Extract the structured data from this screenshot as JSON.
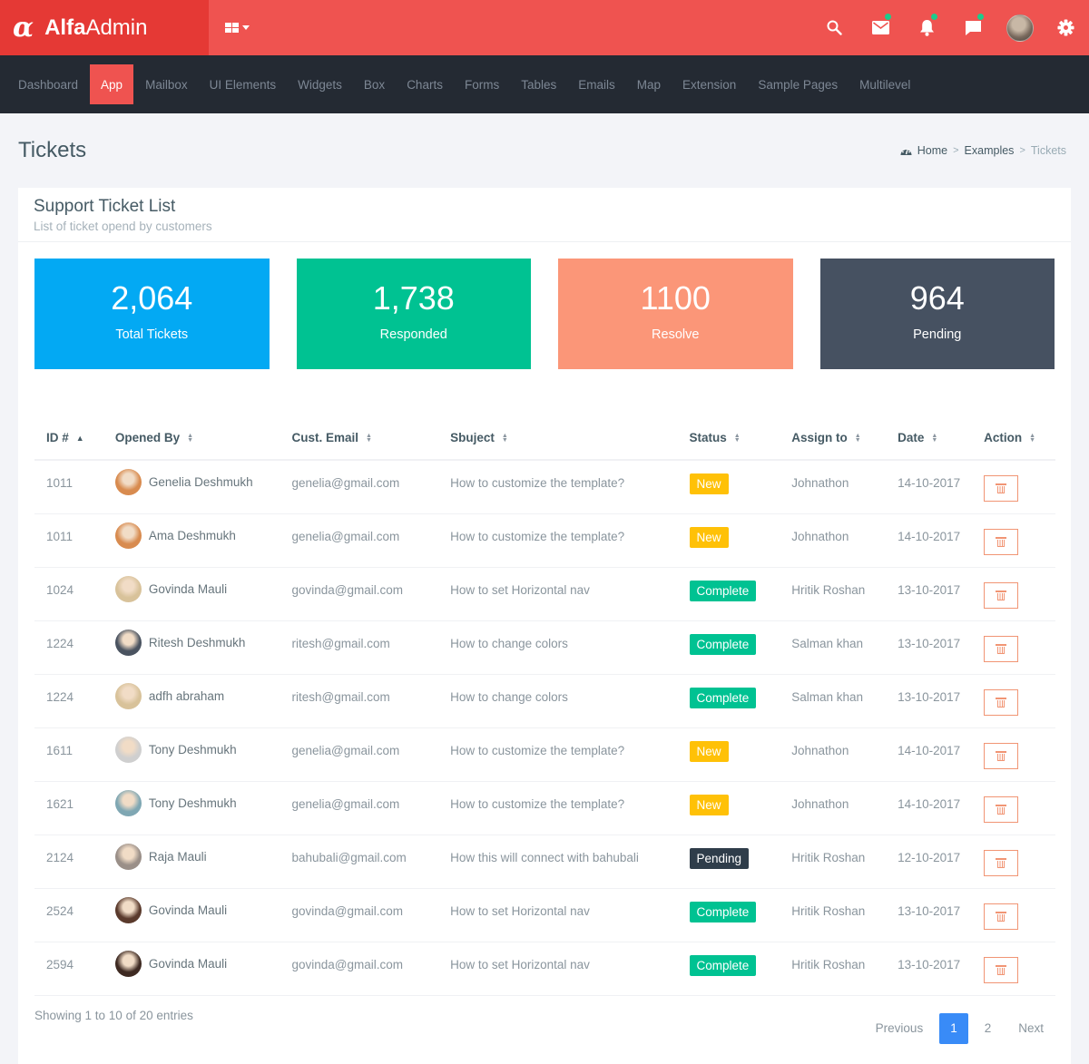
{
  "app": {
    "logo_glyph": "α",
    "brand_bold": "Alfa",
    "brand_light": "Admin",
    "colors": {
      "primary": "#ef5350",
      "brand_bg": "#e53935",
      "nav_bg": "#242a33",
      "notify_dot": "#1ccc8c"
    }
  },
  "topbar": {
    "icons": [
      {
        "name": "search-icon",
        "badge": false
      },
      {
        "name": "mail-icon",
        "badge": true
      },
      {
        "name": "bell-icon",
        "badge": true
      },
      {
        "name": "chat-icon",
        "badge": true
      },
      {
        "name": "user-avatar",
        "badge": false
      },
      {
        "name": "gear-icon",
        "badge": false
      }
    ]
  },
  "nav": {
    "items": [
      {
        "label": "Dashboard",
        "active": false
      },
      {
        "label": "App",
        "active": true
      },
      {
        "label": "Mailbox",
        "active": false
      },
      {
        "label": "UI Elements",
        "active": false
      },
      {
        "label": "Widgets",
        "active": false
      },
      {
        "label": "Box",
        "active": false
      },
      {
        "label": "Charts",
        "active": false
      },
      {
        "label": "Forms",
        "active": false
      },
      {
        "label": "Tables",
        "active": false
      },
      {
        "label": "Emails",
        "active": false
      },
      {
        "label": "Map",
        "active": false
      },
      {
        "label": "Extension",
        "active": false
      },
      {
        "label": "Sample Pages",
        "active": false
      },
      {
        "label": "Multilevel",
        "active": false
      }
    ]
  },
  "page": {
    "title": "Tickets",
    "breadcrumb": {
      "home": "Home",
      "section": "Examples",
      "current": "Tickets",
      "separator": ">"
    }
  },
  "card": {
    "title": "Support Ticket List",
    "subtitle": "List of ticket opend by customers"
  },
  "stats": [
    {
      "value": "2,064",
      "label": "Total Tickets",
      "color": "#03a9f3"
    },
    {
      "value": "1,738",
      "label": "Responded",
      "color": "#00c292"
    },
    {
      "value": "1100",
      "label": "Resolve",
      "color": "#fb9678"
    },
    {
      "value": "964",
      "label": "Pending",
      "color": "#465161"
    }
  ],
  "table": {
    "columns": [
      {
        "label": "ID #",
        "sort": "asc"
      },
      {
        "label": "Opened By",
        "sort": "none"
      },
      {
        "label": "Cust. Email",
        "sort": "none"
      },
      {
        "label": "Sbuject",
        "sort": "none"
      },
      {
        "label": "Status",
        "sort": "none"
      },
      {
        "label": "Assign to",
        "sort": "none"
      },
      {
        "label": "Date",
        "sort": "none"
      },
      {
        "label": "Action",
        "sort": "none"
      }
    ],
    "status_colors": {
      "New": "#ffc107",
      "Complete": "#00c292",
      "Pending": "#2f3d4a"
    },
    "rows": [
      {
        "id": "1011",
        "name": "Genelia Deshmukh",
        "email": "genelia@gmail.com",
        "subject": "How to customize the template?",
        "status": "New",
        "assignee": "Johnathon",
        "date": "14-10-2017",
        "avatar_color": "#d88b4f"
      },
      {
        "id": "1011",
        "name": "Ama Deshmukh",
        "email": "genelia@gmail.com",
        "subject": "How to customize the template?",
        "status": "New",
        "assignee": "Johnathon",
        "date": "14-10-2017",
        "avatar_color": "#d88b4f"
      },
      {
        "id": "1024",
        "name": "Govinda Mauli",
        "email": "govinda@gmail.com",
        "subject": "How to set Horizontal nav",
        "status": "Complete",
        "assignee": "Hritik Roshan",
        "date": "13-10-2017",
        "avatar_color": "#d8c29a"
      },
      {
        "id": "1224",
        "name": "Ritesh Deshmukh",
        "email": "ritesh@gmail.com",
        "subject": "How to change colors",
        "status": "Complete",
        "assignee": "Salman khan",
        "date": "13-10-2017",
        "avatar_color": "#4a5360"
      },
      {
        "id": "1224",
        "name": "adfh abraham",
        "email": "ritesh@gmail.com",
        "subject": "How to change colors",
        "status": "Complete",
        "assignee": "Salman khan",
        "date": "13-10-2017",
        "avatar_color": "#d8c29a"
      },
      {
        "id": "1611",
        "name": "Tony Deshmukh",
        "email": "genelia@gmail.com",
        "subject": "How to customize the template?",
        "status": "New",
        "assignee": "Johnathon",
        "date": "14-10-2017",
        "avatar_color": "#cfcfcf"
      },
      {
        "id": "1621",
        "name": "Tony Deshmukh",
        "email": "genelia@gmail.com",
        "subject": "How to customize the template?",
        "status": "New",
        "assignee": "Johnathon",
        "date": "14-10-2017",
        "avatar_color": "#7fa7b3"
      },
      {
        "id": "2124",
        "name": "Raja Mauli",
        "email": "bahubali@gmail.com",
        "subject": "How this will connect with bahubali",
        "status": "Pending",
        "assignee": "Hritik Roshan",
        "date": "12-10-2017",
        "avatar_color": "#9a8f88"
      },
      {
        "id": "2524",
        "name": "Govinda Mauli",
        "email": "govinda@gmail.com",
        "subject": "How to set Horizontal nav",
        "status": "Complete",
        "assignee": "Hritik Roshan",
        "date": "13-10-2017",
        "avatar_color": "#5a3a2c"
      },
      {
        "id": "2594",
        "name": "Govinda Mauli",
        "email": "govinda@gmail.com",
        "subject": "How to set Horizontal nav",
        "status": "Complete",
        "assignee": "Hritik Roshan",
        "date": "13-10-2017",
        "avatar_color": "#3e2a22"
      }
    ]
  },
  "footer": {
    "showing": "Showing 1 to 10 of 20 entries",
    "pagination": {
      "previous": "Previous",
      "pages": [
        "1",
        "2"
      ],
      "current": "1",
      "next": "Next"
    }
  }
}
